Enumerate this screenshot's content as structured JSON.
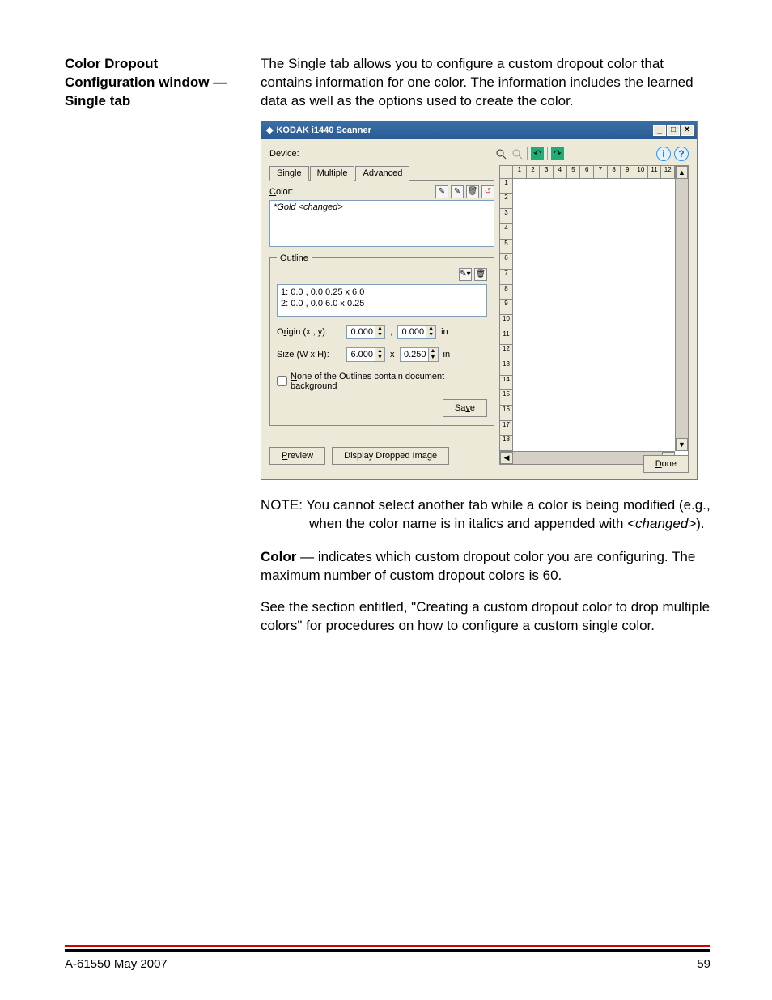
{
  "sidebar": {
    "heading": "Color Dropout Configuration window — Single tab"
  },
  "intro": "The Single tab allows you to configure a custom dropout color that contains information for one color. The information includes the learned data as well as the options used to create the color.",
  "note_prefix": "NOTE: ",
  "note_text_1": "You cannot select another tab while a color is being modified (e.g., when the color name is in italics and appended with ",
  "note_italic": "<changed>",
  "note_text_2": ").",
  "para_color_strong": "Color",
  "para_color_rest": " — indicates which custom dropout color you are configuring. The maximum number of custom dropout colors is 60.",
  "para_see": "See the section entitled, \"Creating a custom dropout color to drop multiple colors\" for procedures on how to configure a custom single color.",
  "footer": {
    "left": "A-61550  May 2007",
    "right": "59"
  },
  "dialog": {
    "title": "KODAK i1440 Scanner",
    "device_label": "Device:",
    "tabs": {
      "single": "Single",
      "multiple": "Multiple",
      "advanced": "Advanced"
    },
    "color_label": "Color:",
    "color_value": "*Gold <changed>",
    "outline_legend": "Outline",
    "outline_items": [
      "1:  0.0 , 0.0   0.25 x 6.0",
      "2:  0.0 , 0.0   6.0 x 0.25"
    ],
    "origin_label": "Origin (x , y):",
    "origin_x": "0.000",
    "origin_sep": ",",
    "origin_y": "0.000",
    "origin_unit": "in",
    "size_label": "Size (W x H):",
    "size_w": "6.000",
    "size_sep": "x",
    "size_h": "0.250",
    "size_unit": "in",
    "checkbox_label": "None of the Outlines contain document background",
    "save_btn": "Save",
    "preview_btn": "Preview",
    "display_btn": "Display Dropped Image",
    "done_btn": "Done",
    "ruler_ticks_top": [
      "1",
      "2",
      "3",
      "4",
      "5",
      "6",
      "7",
      "8",
      "9",
      "10",
      "11",
      "12"
    ],
    "ruler_ticks_left": [
      "1",
      "2",
      "3",
      "4",
      "5",
      "6",
      "7",
      "8",
      "9",
      "10",
      "11",
      "12",
      "13",
      "14",
      "15",
      "16",
      "17",
      "18"
    ]
  }
}
